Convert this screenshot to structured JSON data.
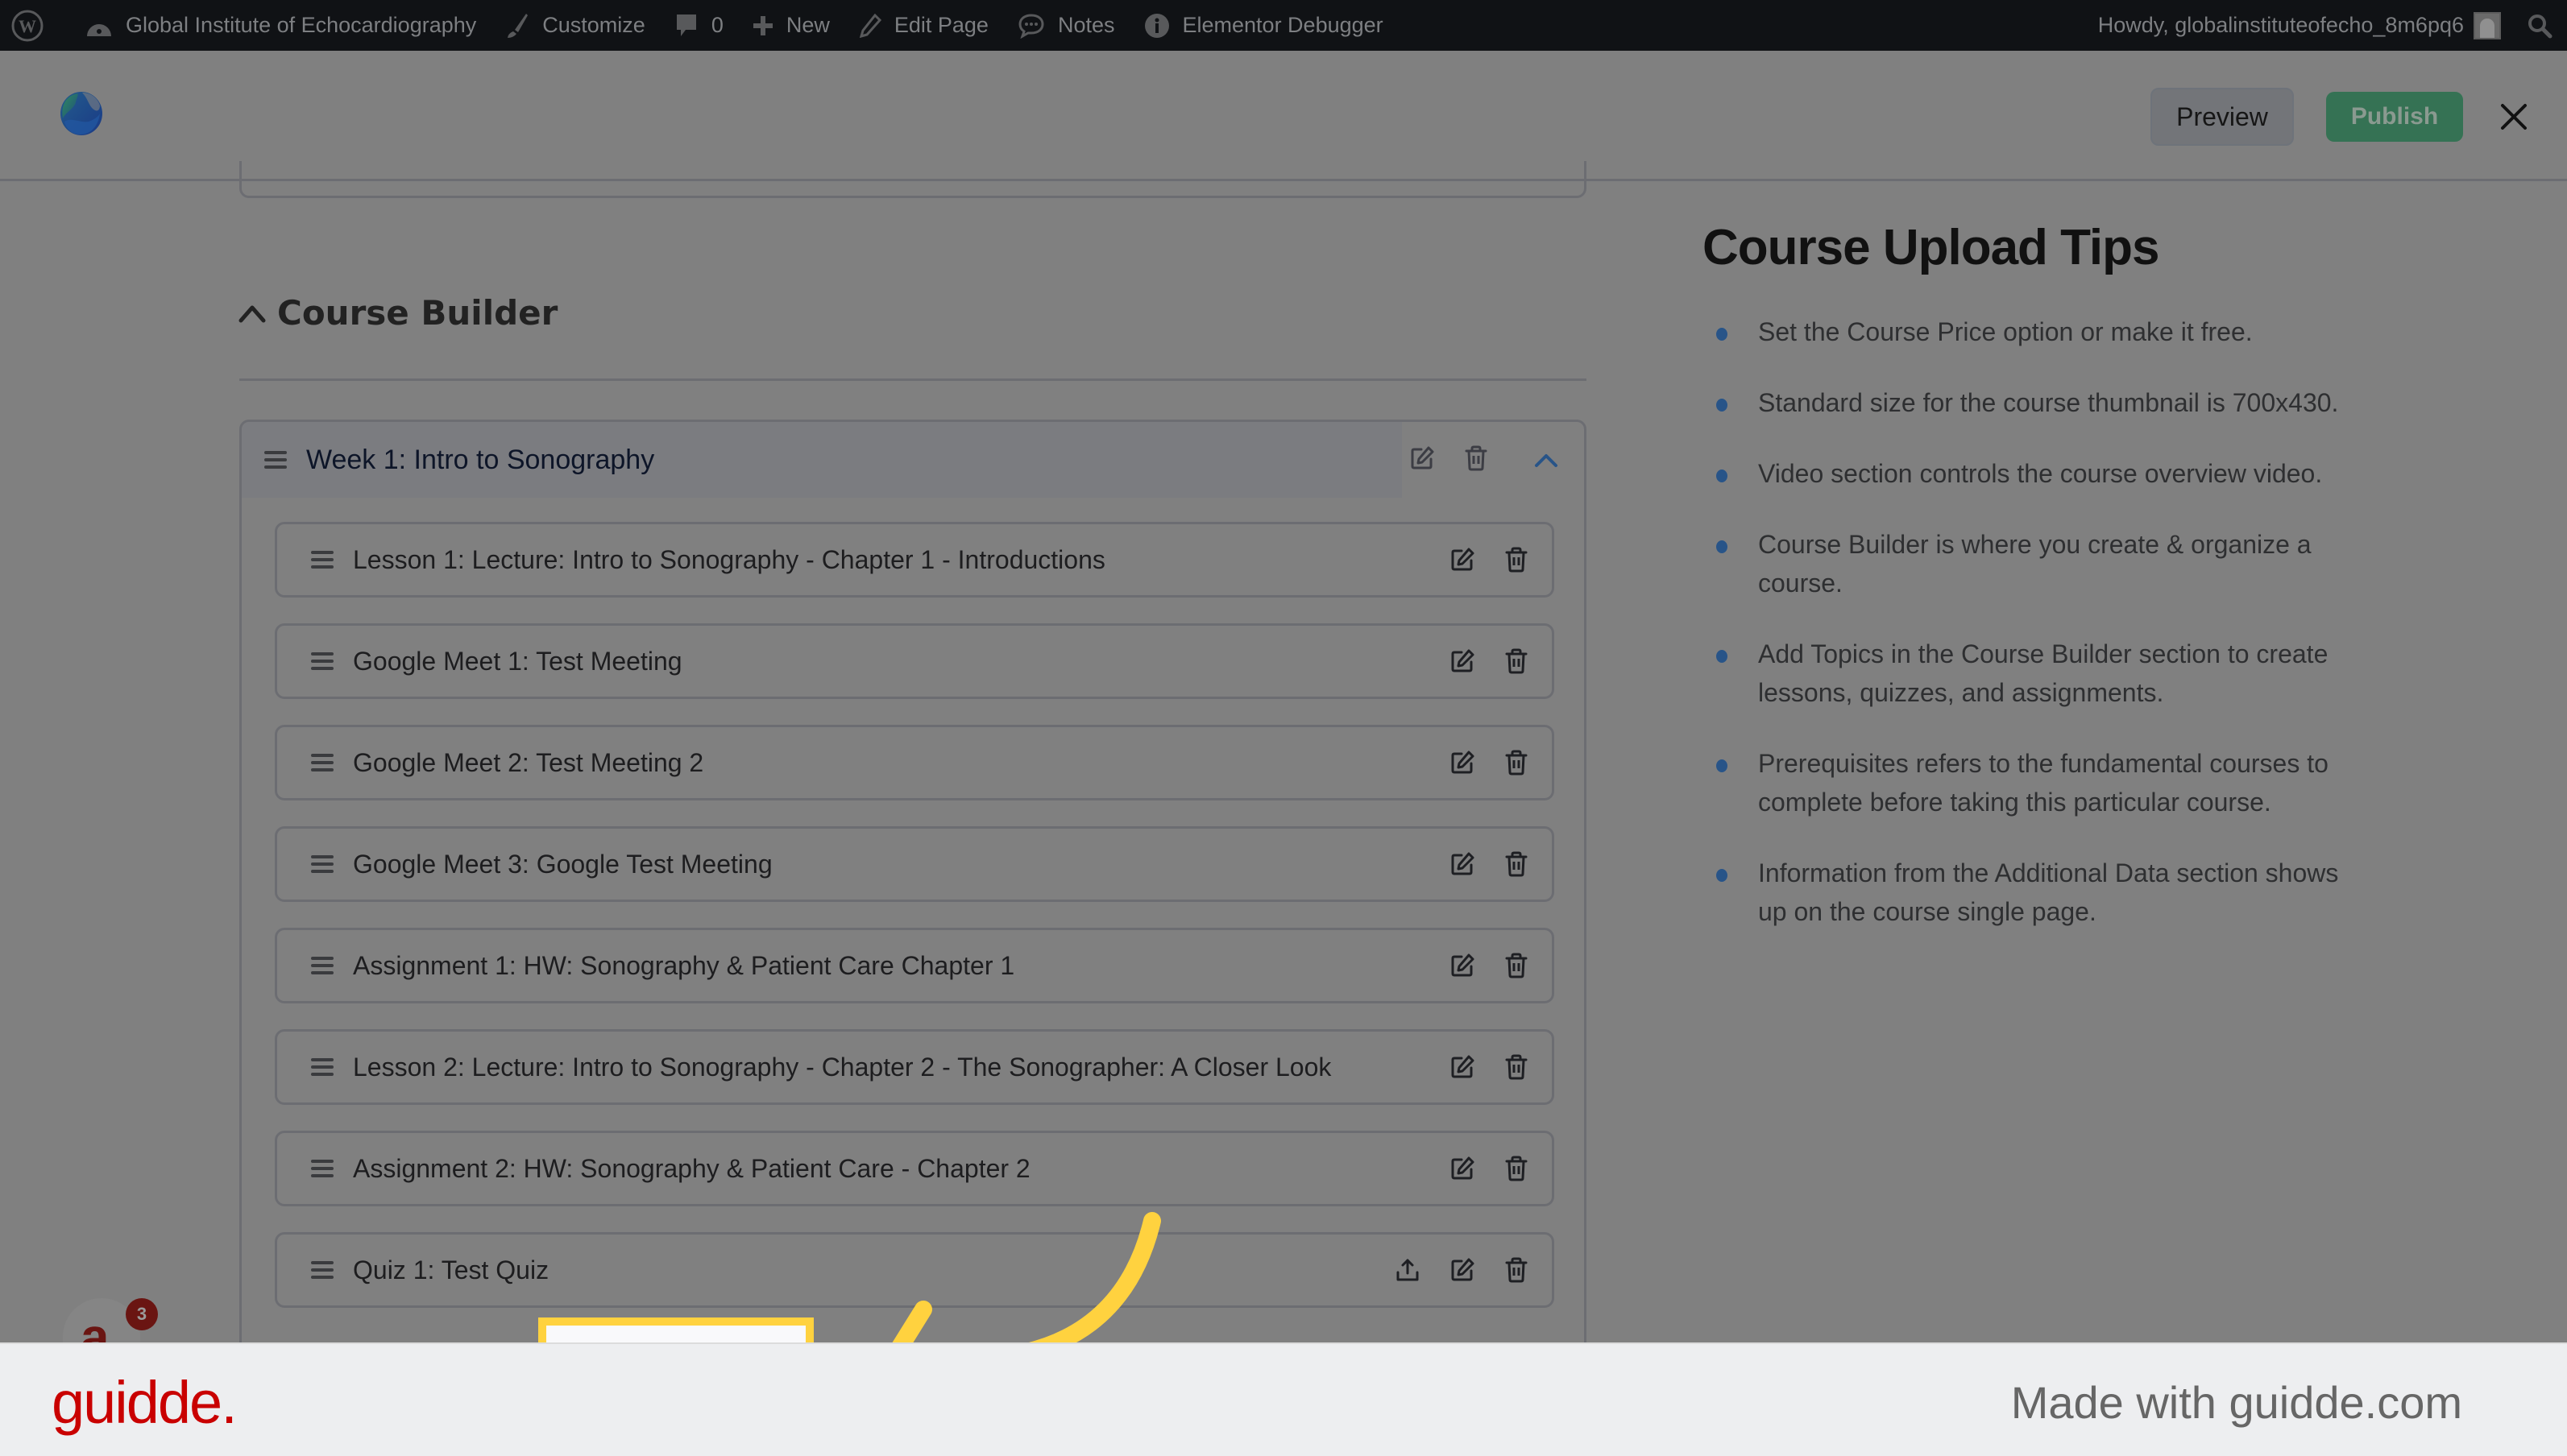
{
  "admin_bar": {
    "site_name": "Global Institute of Echocardiography",
    "customize": "Customize",
    "comments_count": "0",
    "new": "New",
    "edit_page": "Edit Page",
    "notes": "Notes",
    "debugger": "Elementor Debugger",
    "howdy": "Howdy, globalinstituteofecho_8m6pq6"
  },
  "header": {
    "preview": "Preview",
    "publish": "Publish"
  },
  "course_builder": {
    "heading": "Course Builder",
    "topics": [
      {
        "title": "Week 1: Intro to Sonography",
        "items": [
          {
            "title": "Lesson 1: Lecture: Intro to Sonography - Chapter 1 - Introductions",
            "type": "lesson"
          },
          {
            "title": "Google Meet 1: Test Meeting",
            "type": "meeting"
          },
          {
            "title": "Google Meet 2: Test Meeting 2",
            "type": "meeting"
          },
          {
            "title": "Google Meet 3: Google Test Meeting",
            "type": "meeting"
          },
          {
            "title": "Assignment 1: HW: Sonography & Patient Care Chapter 1",
            "type": "assignment"
          },
          {
            "title": "Lesson 2: Lecture: Intro to Sonography - Chapter 2 - The Sonographer: A Closer Look",
            "type": "lesson"
          },
          {
            "title": "Assignment 2: HW: Sonography & Patient Care - Chapter 2",
            "type": "assignment"
          },
          {
            "title": "Quiz 1: Test Quiz",
            "type": "quiz"
          }
        ]
      }
    ]
  },
  "tips": {
    "title": "Course Upload Tips",
    "items": [
      "Set the Course Price option or make it free.",
      "Standard size for the course thumbnail is 700x430.",
      "Video section controls the course overview video.",
      "Course Builder is where you create & organize a course.",
      "Add Topics in the Course Builder section to create lessons, quizzes, and assignments.",
      "Prerequisites refers to the fundamental courses to complete before taking this particular course.",
      "Information from the Additional Data section shows up on the course single page."
    ]
  },
  "widget": {
    "badge_letter": "a",
    "badge_count": "3"
  },
  "footer": {
    "logo": "guidde.",
    "made_with": "Made with guidde.com"
  },
  "colors": {
    "accent_blue": "#285488",
    "publish_green": "#357254",
    "highlight_yellow": "#ffd23f",
    "guidde_red": "#c90000"
  }
}
